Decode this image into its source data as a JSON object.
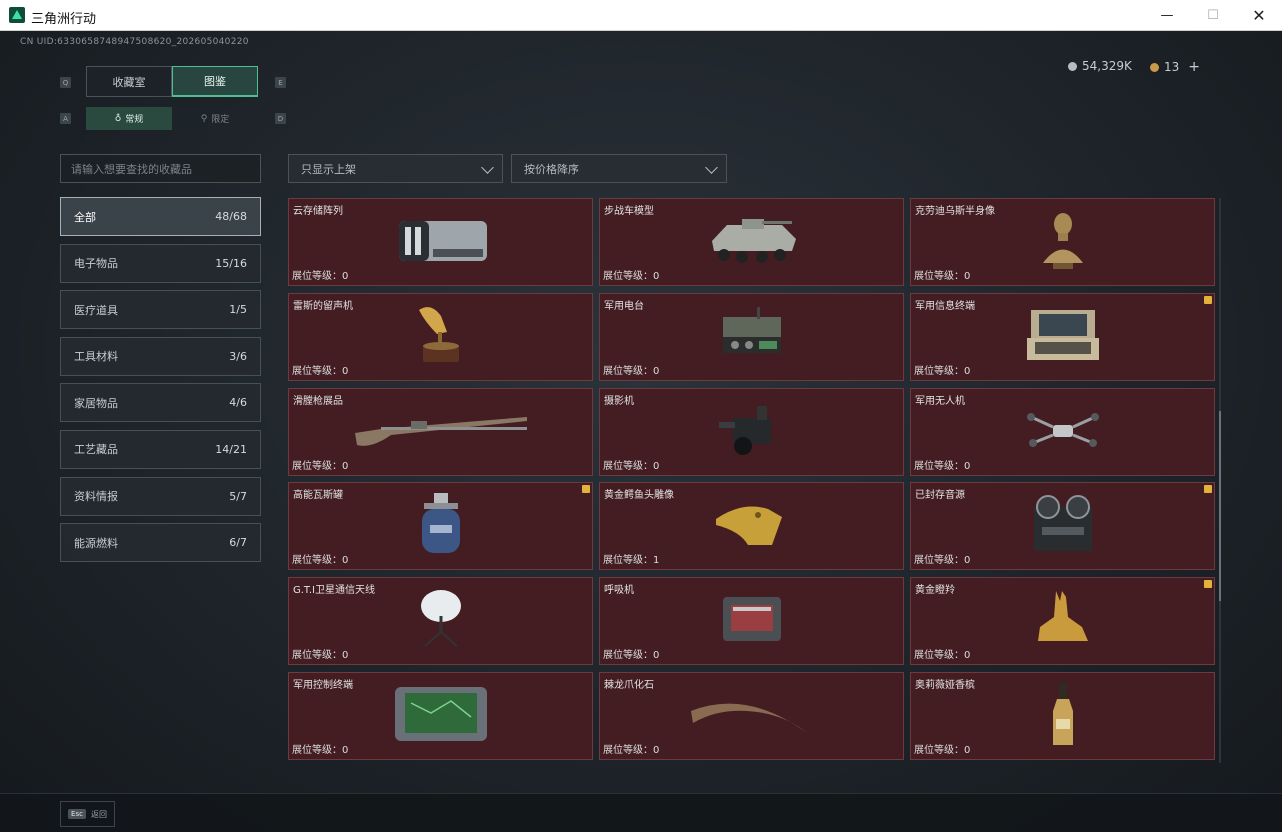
{
  "window": {
    "title": "三角洲行动",
    "min": "—",
    "max": "☐",
    "close": "✕"
  },
  "uid": "CN UID:6330658748947508620_202605040220",
  "currency": {
    "silver": "54,329K",
    "gold": "13",
    "plus": "+"
  },
  "keyhints": {
    "tab_left": "Q",
    "tab_right": "E",
    "sub_left": "A",
    "sub_right": "D"
  },
  "tabs": [
    {
      "label": "收藏室"
    },
    {
      "label": "图鉴"
    }
  ],
  "subtabs": [
    {
      "label": "常规"
    },
    {
      "label": "限定"
    }
  ],
  "search": {
    "placeholder": "请输入想要查找的收藏品"
  },
  "filters": {
    "display": "只显示上架",
    "sort": "按价格降序"
  },
  "categories": [
    {
      "label": "全部",
      "count": "48/68"
    },
    {
      "label": "电子物品",
      "count": "15/16"
    },
    {
      "label": "医疗道具",
      "count": "1/5"
    },
    {
      "label": "工具材料",
      "count": "3/6"
    },
    {
      "label": "家居物品",
      "count": "4/6"
    },
    {
      "label": "工艺藏品",
      "count": "14/21"
    },
    {
      "label": "资料情报",
      "count": "5/7"
    },
    {
      "label": "能源燃料",
      "count": "6/7"
    }
  ],
  "items": [
    {
      "name": "云存储阵列",
      "level": "展位等级：0",
      "icon": "server-icon",
      "badge": false
    },
    {
      "name": "步战车模型",
      "level": "展位等级：0",
      "icon": "ifv-model-icon",
      "badge": false
    },
    {
      "name": "克劳迪乌斯半身像",
      "level": "展位等级：0",
      "icon": "bust-icon",
      "badge": false
    },
    {
      "name": "雷斯的留声机",
      "level": "展位等级：0",
      "icon": "gramophone-icon",
      "badge": false
    },
    {
      "name": "军用电台",
      "level": "展位等级：0",
      "icon": "radio-icon",
      "badge": false
    },
    {
      "name": "军用信息终端",
      "level": "展位等级：0",
      "icon": "terminal-case-icon",
      "badge": true
    },
    {
      "name": "滑膛枪展品",
      "level": "展位等级：0",
      "icon": "musket-icon",
      "badge": false
    },
    {
      "name": "摄影机",
      "level": "展位等级：0",
      "icon": "camera-icon",
      "badge": false
    },
    {
      "name": "军用无人机",
      "level": "展位等级：0",
      "icon": "drone-icon",
      "badge": false
    },
    {
      "name": "高能瓦斯罐",
      "level": "展位等级：0",
      "icon": "gas-canister-icon",
      "badge": true
    },
    {
      "name": "黄金鳄鱼头雕像",
      "level": "展位等级：1",
      "icon": "gold-croc-icon",
      "badge": false
    },
    {
      "name": "已封存音源",
      "level": "展位等级：0",
      "icon": "reel-recorder-icon",
      "badge": true
    },
    {
      "name": "G.T.I卫星通信天线",
      "level": "展位等级：0",
      "icon": "satellite-dish-icon",
      "badge": false
    },
    {
      "name": "呼吸机",
      "level": "展位等级：0",
      "icon": "ventilator-icon",
      "badge": false
    },
    {
      "name": "黄金瞪羚",
      "level": "展位等级：0",
      "icon": "gold-gazelle-icon",
      "badge": true
    },
    {
      "name": "军用控制终端",
      "level": "展位等级：0",
      "icon": "control-terminal-icon",
      "badge": false
    },
    {
      "name": "棘龙爪化石",
      "level": "展位等级：0",
      "icon": "claw-fossil-icon",
      "badge": false
    },
    {
      "name": "奥莉薇娅香槟",
      "level": "展位等级：0",
      "icon": "champagne-icon",
      "badge": false
    }
  ],
  "bottom": {
    "esc_key": "Esc",
    "esc_label": "返回"
  }
}
